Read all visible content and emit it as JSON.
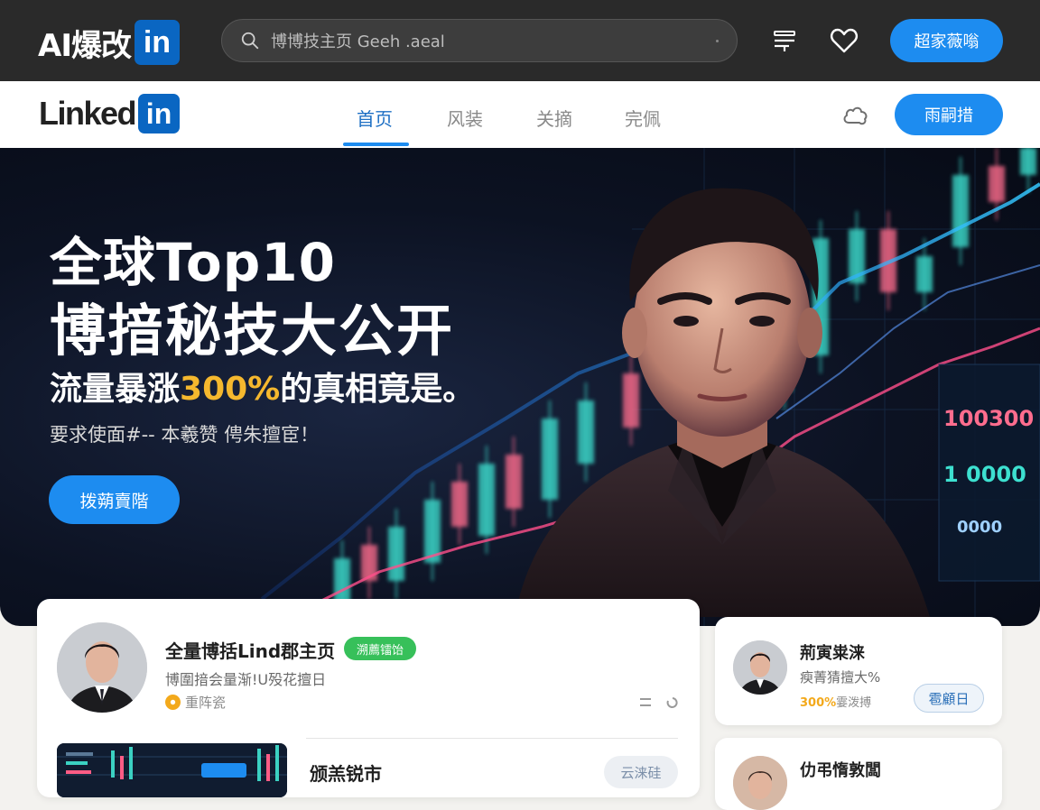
{
  "topbar": {
    "brand": "AI爆改",
    "brand_badge": "in",
    "search_text": "博博技主页 Geeh .aeal",
    "action_button": "超家薇嗡",
    "icons": [
      "search-icon",
      "menu-icon",
      "heart-icon"
    ]
  },
  "nav": {
    "logo_text": "Linked",
    "logo_badge": "in",
    "tabs": [
      {
        "label": "首页",
        "active": true
      },
      {
        "label": "风装",
        "active": false
      },
      {
        "label": "关摘",
        "active": false
      },
      {
        "label": "完佩",
        "active": false
      }
    ],
    "button": "雨嗣措",
    "icons": [
      "gear-icon"
    ]
  },
  "hero": {
    "title_line1": "全球Top10",
    "title_line2": "博揞秘技大公开",
    "title_line3_pre": "流量暴涨",
    "title_line3_highlight": "300%",
    "title_line3_post": "的真相竟是。",
    "subtitle": "要求使面#-- 本羲赞 俜朱擅宦！",
    "button": "拨蒴賣階",
    "metrics": [
      "100300",
      "1 0000",
      "0000"
    ],
    "colors": {
      "highlight": "#f5b82e",
      "accent": "#1d8cf0"
    }
  },
  "profile": {
    "name": "全量博括Lind郡主页",
    "badge": "溯薦镭饴",
    "description": "博圍揞会量渐!U殁花擅日",
    "coin_label": "重阵瓷",
    "post_title": "颁羔锐市",
    "post_tag": "云涞硅"
  },
  "side_cards": [
    {
      "name": "荊寅粜涞",
      "description": "瘐菁猜擅大%",
      "stat_highlight": "300%",
      "stat_rest": "霎泼搏",
      "button": "雹顧日"
    },
    {
      "name": "仂弔惰敦闆"
    }
  ]
}
